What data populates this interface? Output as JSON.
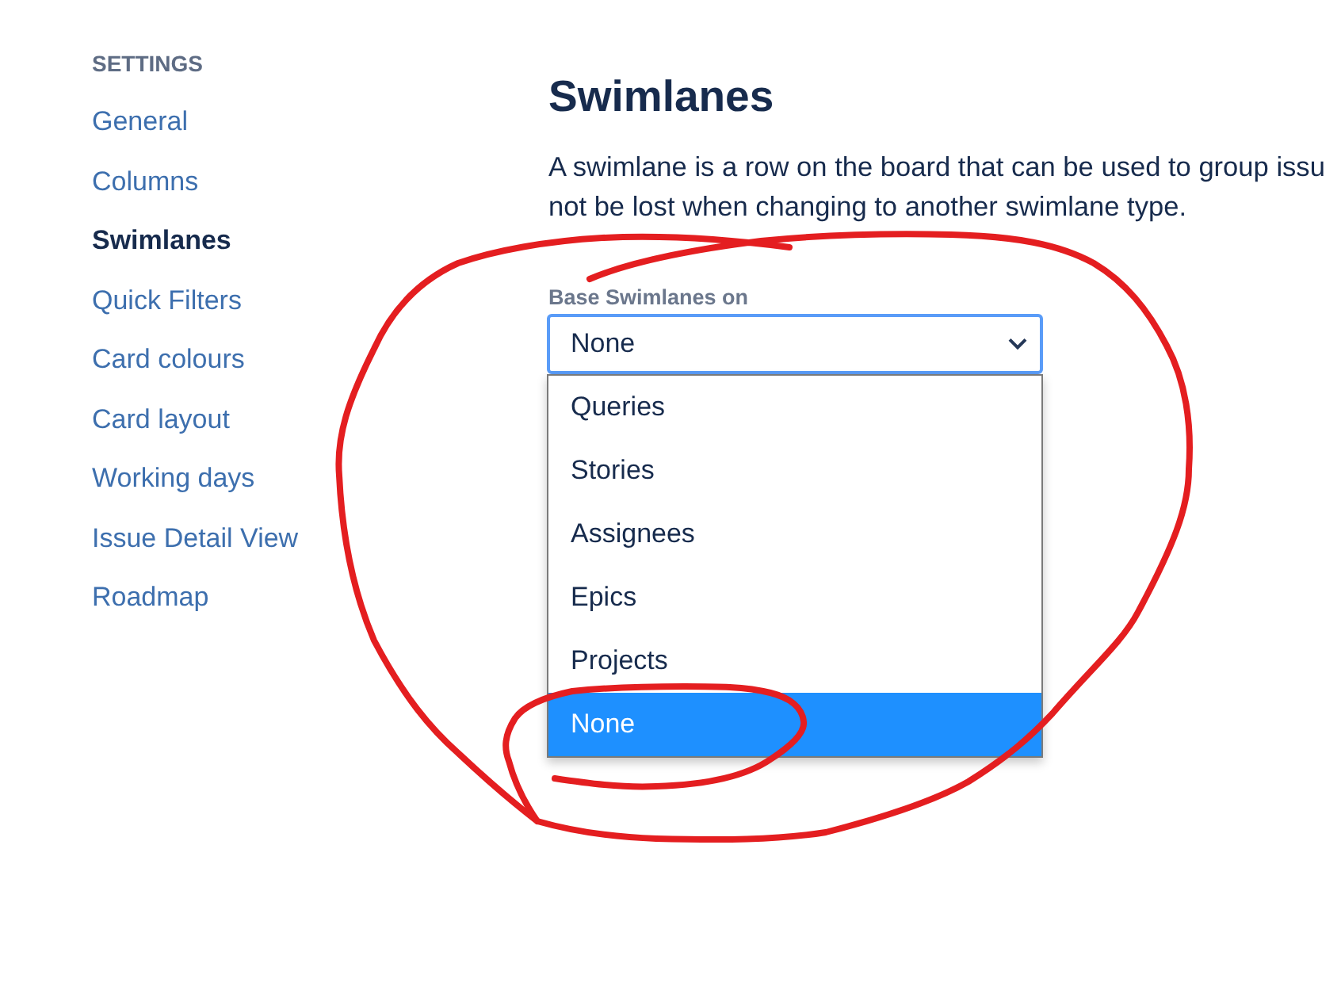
{
  "sidebar": {
    "heading": "SETTINGS",
    "items": [
      {
        "label": "General",
        "selected": false
      },
      {
        "label": "Columns",
        "selected": false
      },
      {
        "label": "Swimlanes",
        "selected": true
      },
      {
        "label": "Quick Filters",
        "selected": false
      },
      {
        "label": "Card colours",
        "selected": false
      },
      {
        "label": "Card layout",
        "selected": false
      },
      {
        "label": "Working days",
        "selected": false
      },
      {
        "label": "Issue Detail View",
        "selected": false
      },
      {
        "label": "Roadmap",
        "selected": false
      }
    ]
  },
  "main": {
    "title": "Swimlanes",
    "description_lines": [
      "A swimlane is a row on the board that can be used to group issu",
      "not be lost when changing to another swimlane type."
    ],
    "field": {
      "label": "Base Swimlanes on",
      "value": "None",
      "expanded": true,
      "options": [
        {
          "label": "Queries",
          "selected": false
        },
        {
          "label": "Stories",
          "selected": false
        },
        {
          "label": "Assignees",
          "selected": false
        },
        {
          "label": "Epics",
          "selected": false
        },
        {
          "label": "Projects",
          "selected": false
        },
        {
          "label": "None",
          "selected": true
        }
      ]
    }
  },
  "annotations": [
    {
      "kind": "loop"
    },
    {
      "kind": "loop"
    }
  ]
}
